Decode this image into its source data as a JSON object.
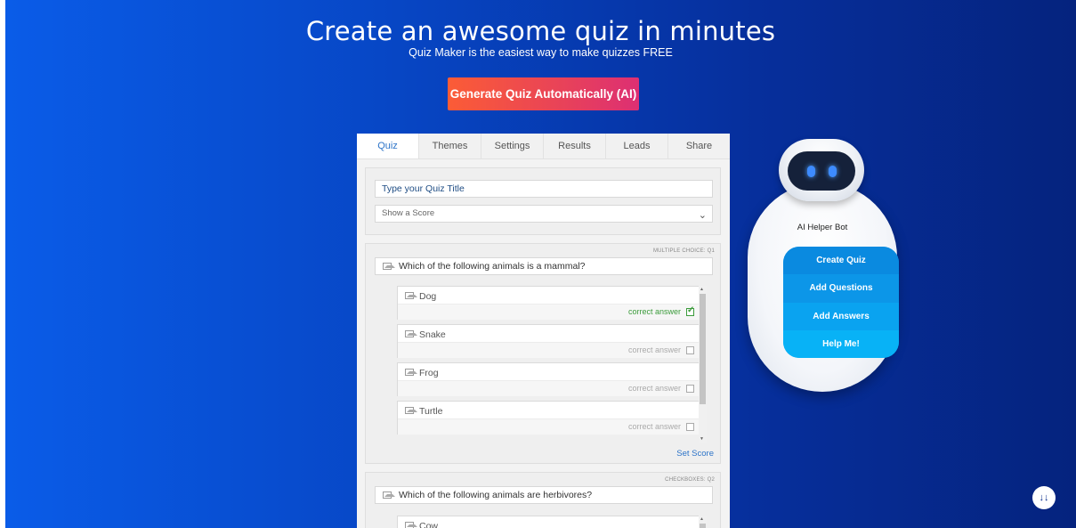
{
  "hero": {
    "title": "Create an awesome quiz in minutes",
    "subtitle": "Quiz Maker is the easiest way to make quizzes FREE",
    "generate_button": "Generate Quiz Automatically (AI)"
  },
  "tabs": [
    "Quiz",
    "Themes",
    "Settings",
    "Results",
    "Leads",
    "Share"
  ],
  "quiz_settings": {
    "title_placeholder": "Type your Quiz Title",
    "score_select": "Show a Score"
  },
  "questions": [
    {
      "type_label": "MULTIPLE CHOICE: Q1",
      "text": "Which of the following animals is a mammal?",
      "answers": [
        {
          "label": "Dog",
          "correct_label": "correct answer",
          "correct": true
        },
        {
          "label": "Snake",
          "correct_label": "correct answer",
          "correct": false
        },
        {
          "label": "Frog",
          "correct_label": "correct answer",
          "correct": false
        },
        {
          "label": "Turtle",
          "correct_label": "correct answer",
          "correct": false
        }
      ],
      "set_score": "Set Score"
    },
    {
      "type_label": "CHECKBOXES: Q2",
      "text": "Which of the following animals are herbivores?",
      "answers": [
        {
          "label": "Cow"
        }
      ]
    }
  ],
  "bot": {
    "name": "AI Helper Bot",
    "buttons": [
      "Create Quiz",
      "Add Questions",
      "Add Answers",
      "Help Me!"
    ],
    "button_colors": [
      "#0a8ae0",
      "#0c96e8",
      "#0aa3f0",
      "#08b2f6"
    ]
  },
  "scroll_down_icon": "double-chevron-down-icon"
}
